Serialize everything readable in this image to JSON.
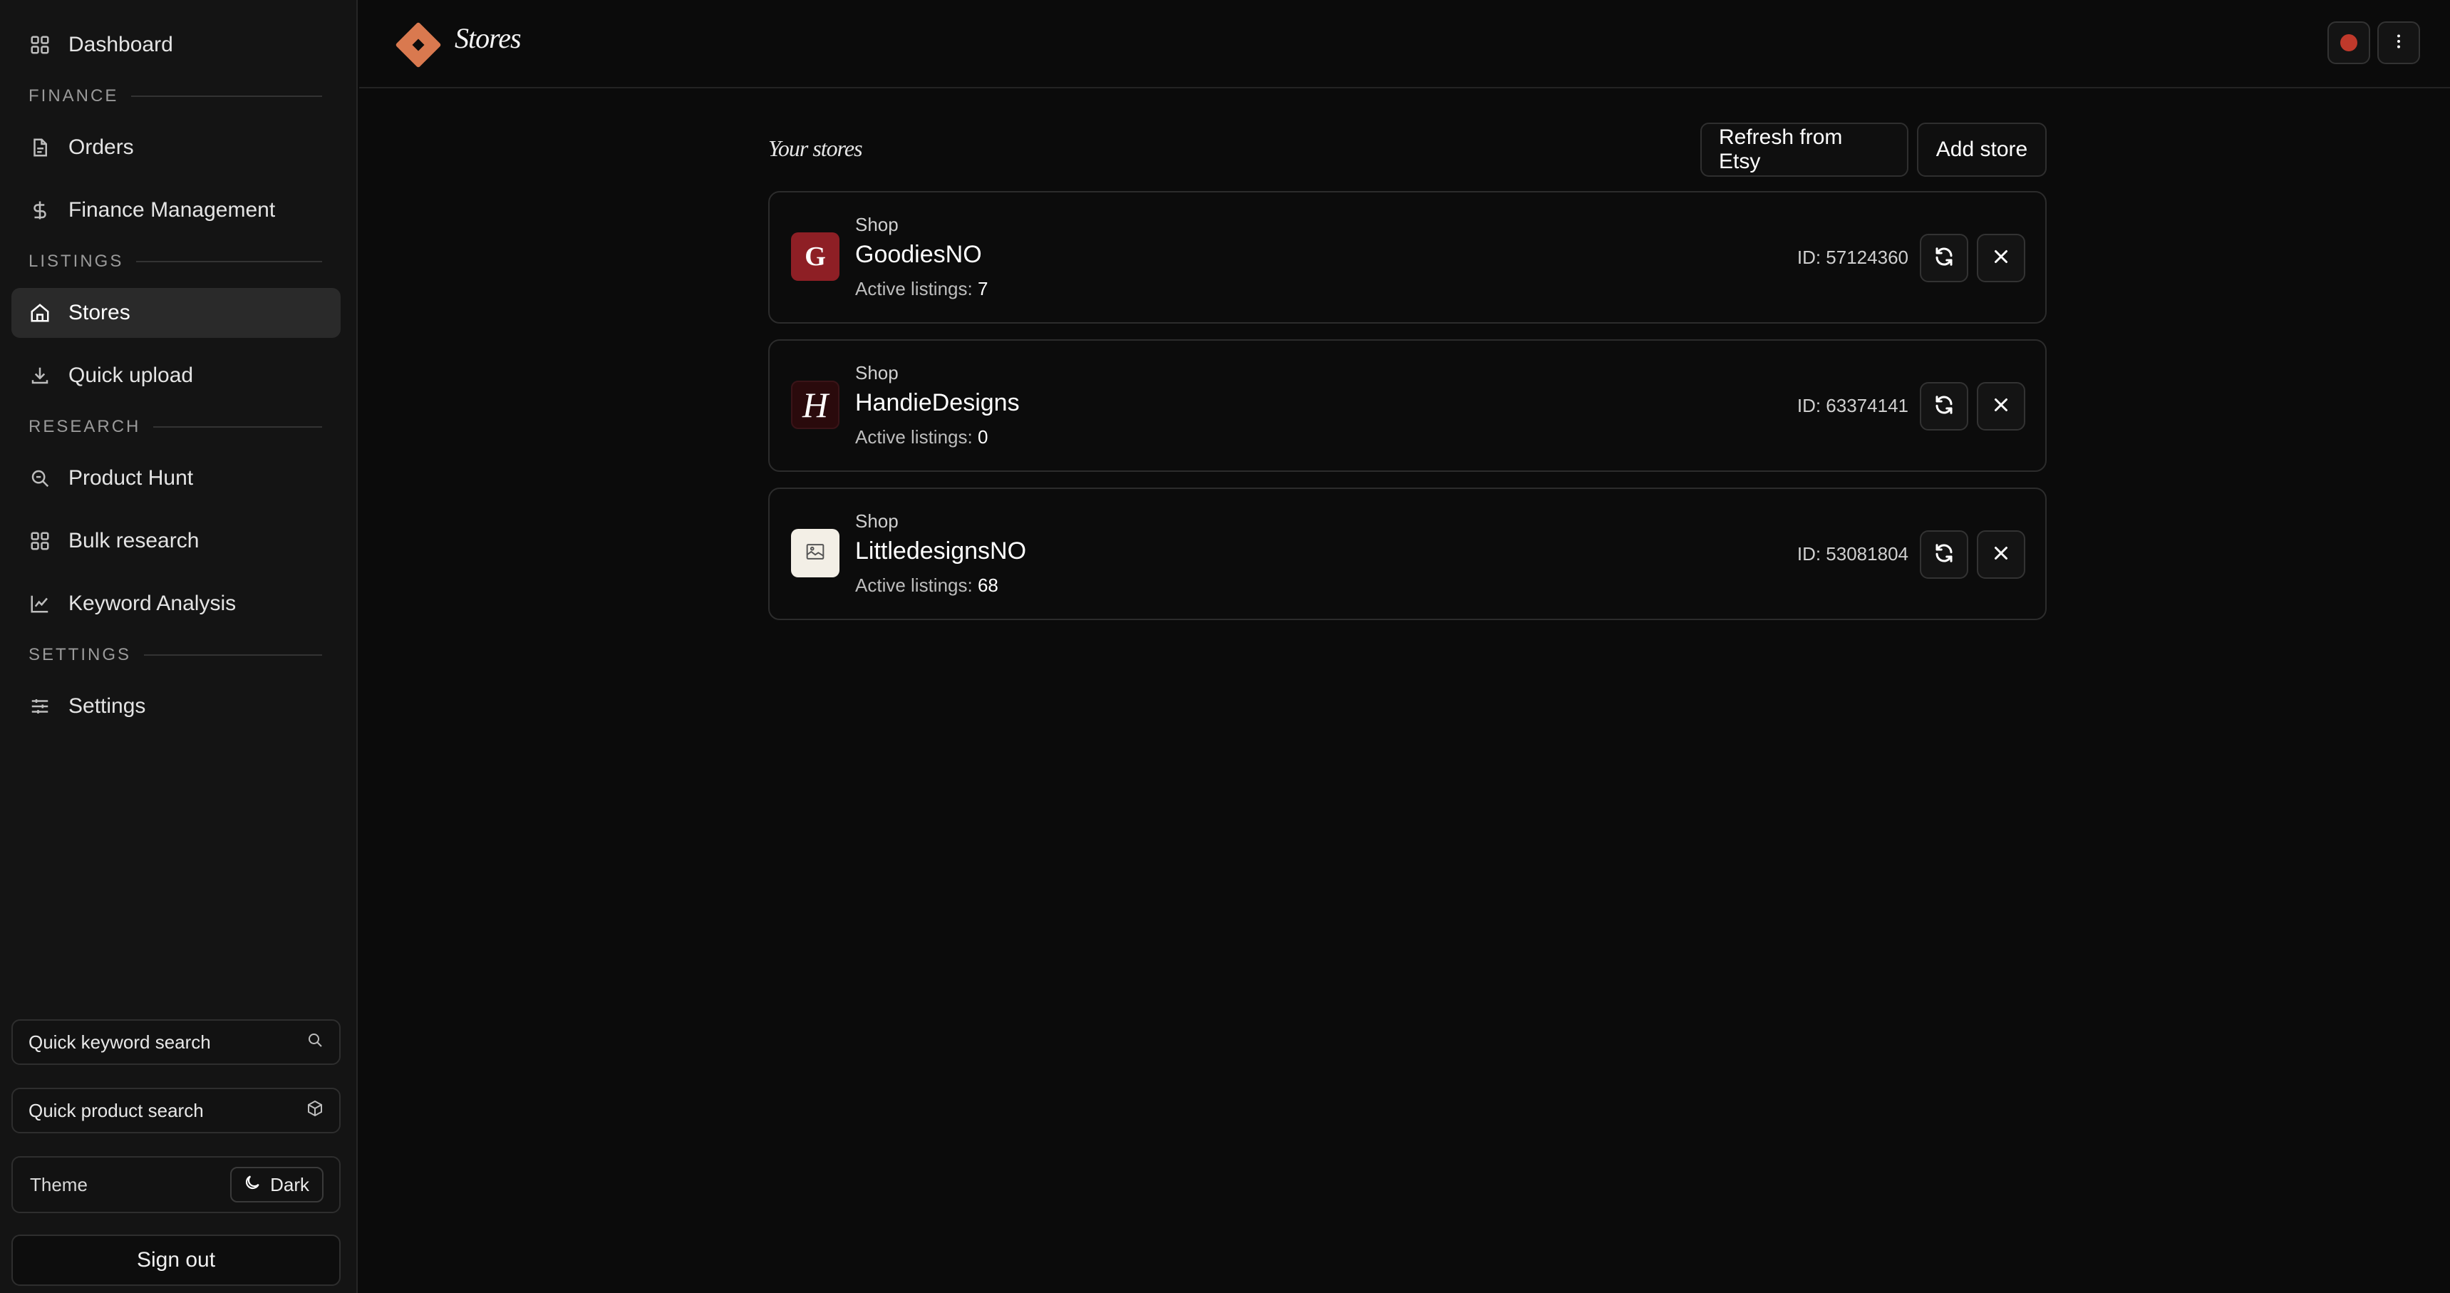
{
  "sidebar": {
    "nav": {
      "dashboard": "Dashboard",
      "orders": "Orders",
      "finance_management": "Finance Management",
      "stores": "Stores",
      "quick_upload": "Quick upload",
      "product_hunt": "Product Hunt",
      "bulk_research": "Bulk research",
      "keyword_analysis": "Keyword Analysis",
      "settings": "Settings"
    },
    "sections": {
      "finance": "FINANCE",
      "listings": "LISTINGS",
      "research": "RESEARCH",
      "settings": "SETTINGS"
    },
    "active_item": "Stores",
    "quick_keyword_placeholder": "Quick keyword search",
    "quick_product_placeholder": "Quick product search",
    "theme_label": "Theme",
    "theme_value": "Dark",
    "sign_out": "Sign out"
  },
  "header": {
    "title": "Stores",
    "record_indicator_color": "#c0392b",
    "logo_color": "#d9794f"
  },
  "main": {
    "section_title": "Your stores",
    "refresh_button": "Refresh from Etsy",
    "add_button": "Add store",
    "stores": [
      {
        "kind": "Shop",
        "name": "GoodiesNO",
        "listings_label": "Active listings:",
        "listings_count": "7",
        "id_text": "ID: 57124360",
        "avatar_letter": "G"
      },
      {
        "kind": "Shop",
        "name": "HandieDesigns",
        "listings_label": "Active listings:",
        "listings_count": "0",
        "id_text": "ID: 63374141",
        "avatar_letter": "H"
      },
      {
        "kind": "Shop",
        "name": "LittledesignsNO",
        "listings_label": "Active listings:",
        "listings_count": "68",
        "id_text": "ID: 53081804",
        "avatar_letter": ""
      }
    ]
  }
}
